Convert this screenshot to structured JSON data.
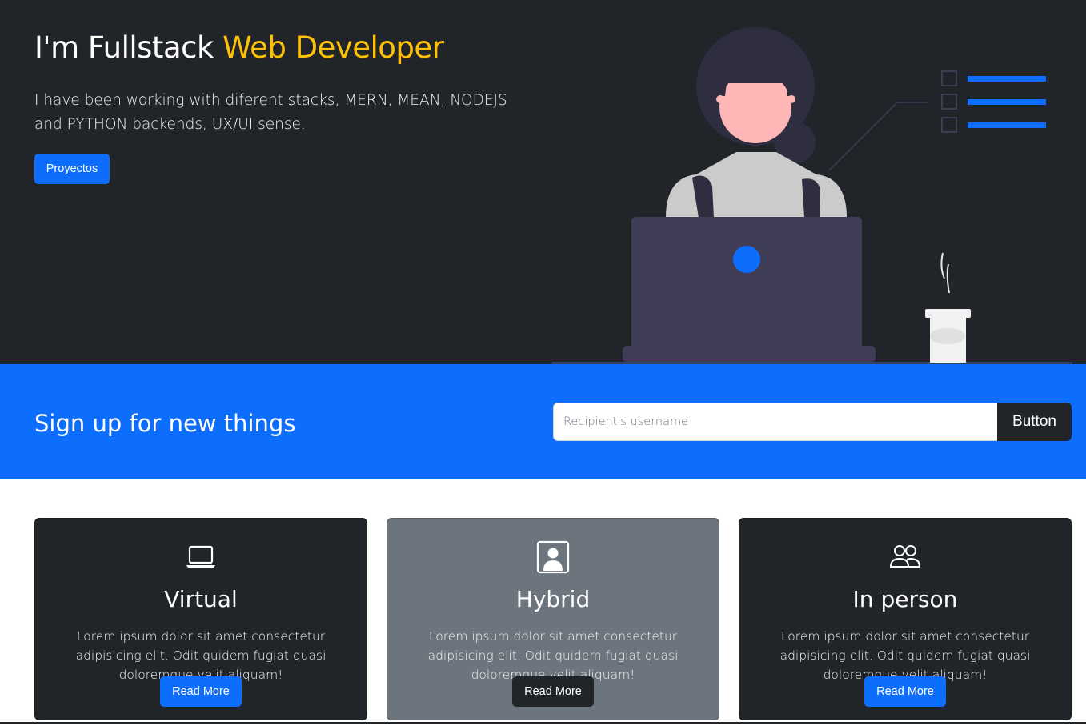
{
  "hero": {
    "title_prefix": "I'm Fullstack ",
    "title_accent": "Web Developer",
    "lead": "I have been working with diferent stacks, MERN, MEAN, NODEJS and PYTHON backends, UX/UI sense.",
    "button_label": "Proyectos"
  },
  "signup": {
    "title": "Sign up for new things",
    "input_placeholder": "Recipient's username",
    "input_value": "",
    "button_label": "Button"
  },
  "cards": [
    {
      "icon": "laptop-icon",
      "title": "Virtual",
      "text": "Lorem ipsum dolor sit amet consectetur adipisicing elit. Odit quidem fugiat quasi doloremque velit aliquam!",
      "button_label": "Read More"
    },
    {
      "icon": "person-square-icon",
      "title": "Hybrid",
      "text": "Lorem ipsum dolor sit amet consectetur adipisicing elit. Odit quidem fugiat quasi doloremque velit aliquam!",
      "button_label": "Read More"
    },
    {
      "icon": "people-icon",
      "title": "In person",
      "text": "Lorem ipsum dolor sit amet consectetur adipisicing elit. Odit quidem fugiat quasi doloremque velit aliquam!",
      "button_label": "Read More"
    }
  ],
  "colors": {
    "dark": "#212529",
    "primary": "#0d6efd",
    "accent": "#ffc107",
    "gray": "#6c757d"
  }
}
